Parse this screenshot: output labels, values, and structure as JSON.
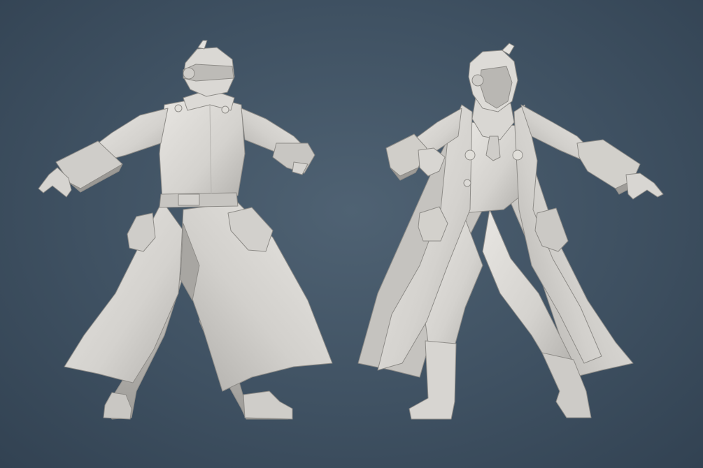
{
  "scene": {
    "background_top": "#4a5c6d",
    "background_bottom": "#334353",
    "model_color": "#d9d7d3",
    "model_shadow": "#a9a7a3",
    "views": [
      "back",
      "front"
    ]
  }
}
